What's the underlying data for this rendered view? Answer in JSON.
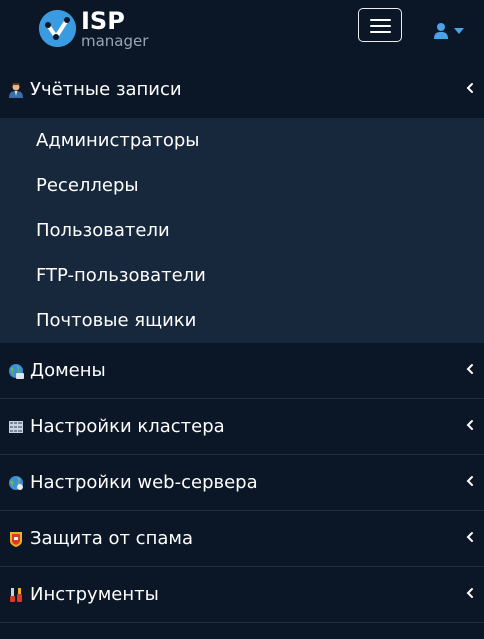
{
  "app": {
    "logo_isp": "ISP",
    "logo_manager": "manager"
  },
  "header": {
    "hamburger_icon": "hamburger-icon",
    "user_icon": "user-icon",
    "caret_icon": "caret-down-icon"
  },
  "menu": {
    "sections": [
      {
        "label": "Учётные записи",
        "icon": "accounts-icon",
        "expanded": true
      },
      {
        "label": "Домены",
        "icon": "domains-icon",
        "expanded": false
      },
      {
        "label": "Настройки кластера",
        "icon": "cluster-icon",
        "expanded": false
      },
      {
        "label": "Настройки web-сервера",
        "icon": "webserver-icon",
        "expanded": false
      },
      {
        "label": "Защита от спама",
        "icon": "spam-icon",
        "expanded": false
      },
      {
        "label": "Инструменты",
        "icon": "tools-icon",
        "expanded": false
      }
    ],
    "accounts_items": [
      {
        "label": "Администраторы"
      },
      {
        "label": "Реселлеры"
      },
      {
        "label": "Пользователи"
      },
      {
        "label": "FTP-пользователи"
      },
      {
        "label": "Почтовые ящики"
      }
    ]
  },
  "colors": {
    "background": "#0b1627",
    "submenu_background": "#17283d",
    "accent": "#3a9be0",
    "divider": "#1f2c3d"
  }
}
